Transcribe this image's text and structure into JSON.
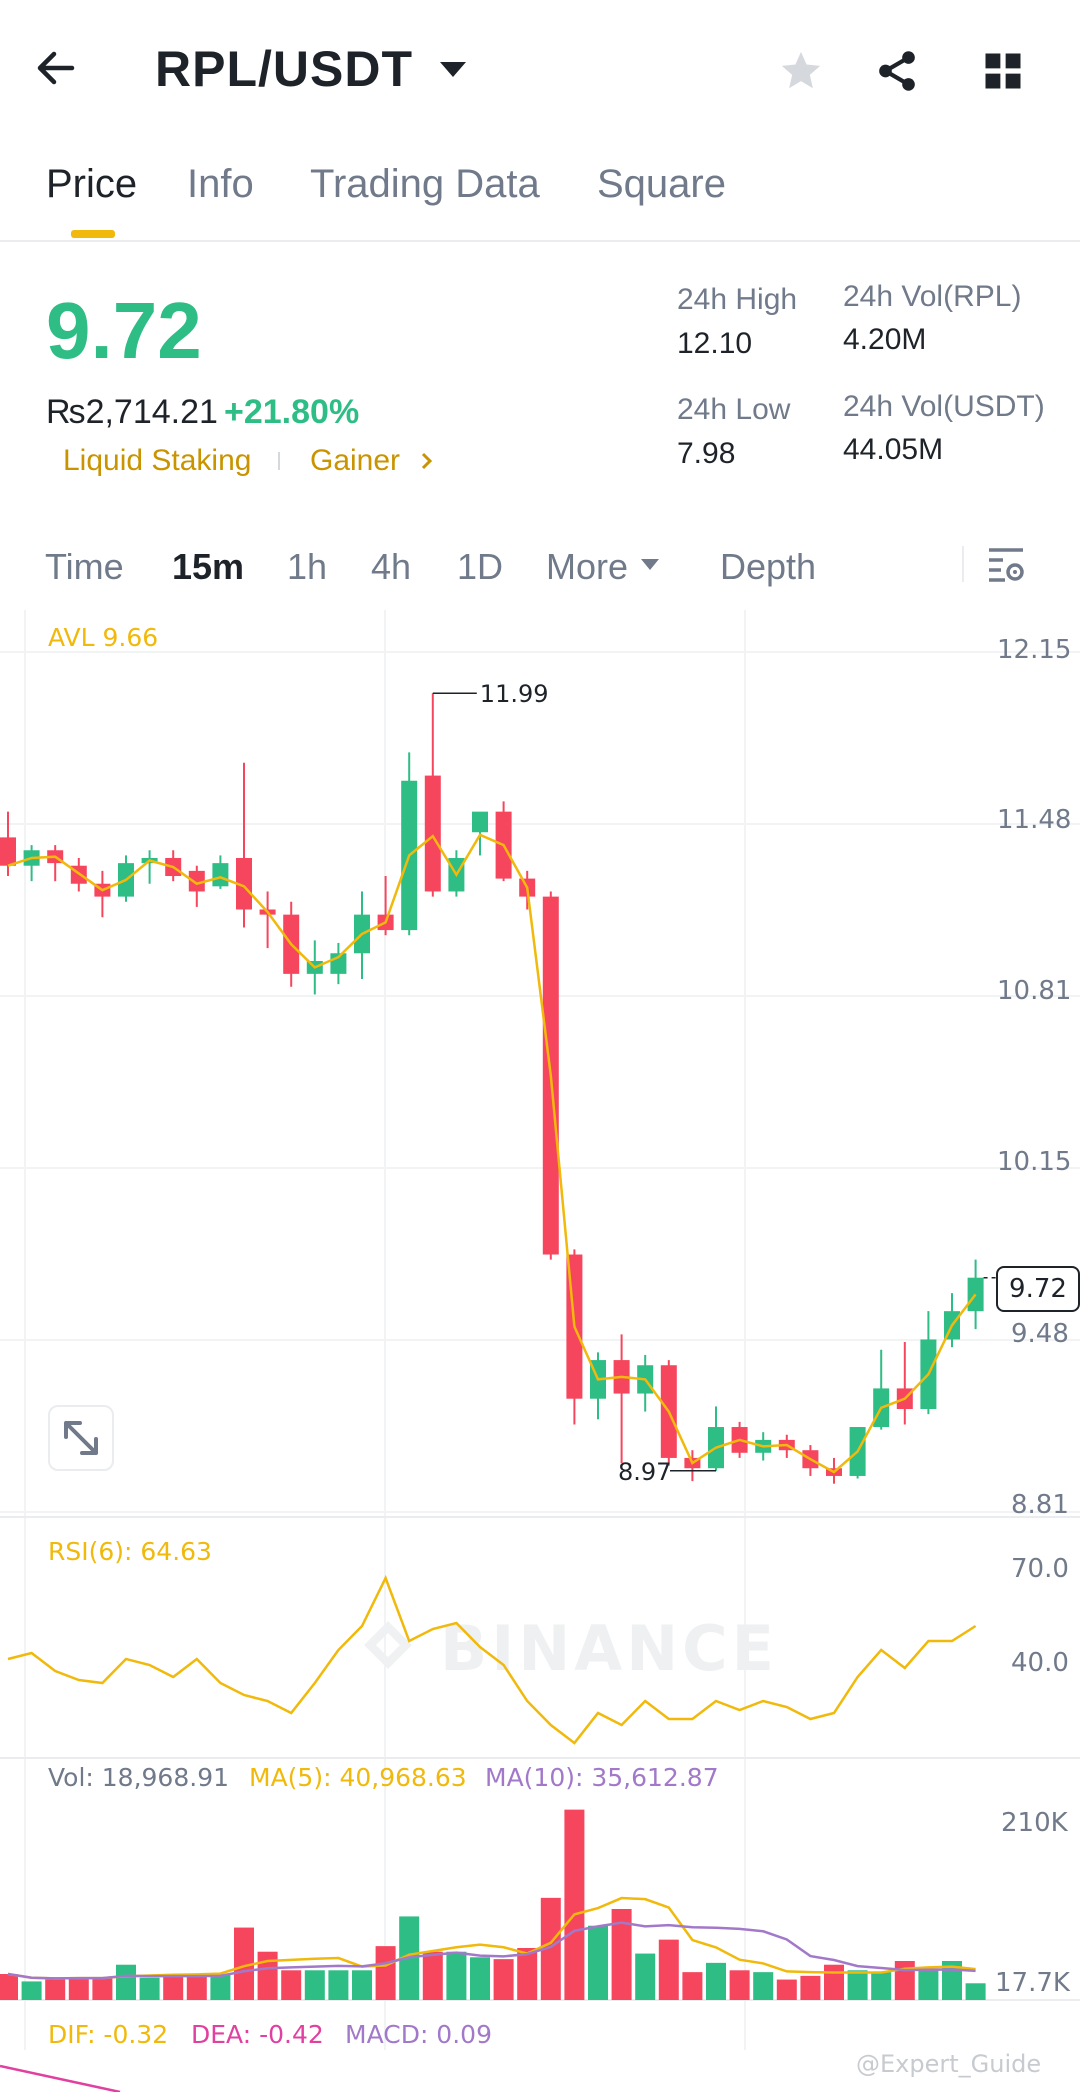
{
  "header": {
    "pair": "RPL/USDT"
  },
  "tabs": [
    {
      "label": "Price",
      "active": true
    },
    {
      "label": "Info"
    },
    {
      "label": "Trading Data"
    },
    {
      "label": "Square"
    }
  ],
  "price": {
    "last": "9.72",
    "fiat": "₨2,714.21",
    "change": "+21.80%",
    "tag1": "Liquid Staking",
    "tag2": "Gainer",
    "high_label": "24h High",
    "high": "12.10",
    "low_label": "24h Low",
    "low": "7.98",
    "vol_base_label": "24h Vol(RPL)",
    "vol_base": "4.20M",
    "vol_quote_label": "24h Vol(USDT)",
    "vol_quote": "44.05M"
  },
  "intervals": {
    "items": [
      "Time",
      "15m",
      "1h",
      "4h",
      "1D"
    ],
    "active": "15m",
    "more": "More",
    "depth": "Depth"
  },
  "colors": {
    "up": "#2ebd85",
    "down": "#f6465d",
    "avl": "#f0b90b",
    "ma10": "#a279c9",
    "dea": "#e040a0"
  },
  "chart_data": {
    "type": "candlestick",
    "price_axis_ticks": [
      "12.15",
      "11.48",
      "10.81",
      "10.15",
      "9.48",
      "8.81"
    ],
    "price_range": [
      8.81,
      12.15
    ],
    "avl_label": "AVL 9.66",
    "high_marker": "11.99",
    "low_marker": "8.97",
    "last_price_label": "9.72",
    "watermark": "BINANCE",
    "candles": [
      {
        "o": 11.43,
        "h": 11.53,
        "l": 11.28,
        "c": 11.32
      },
      {
        "o": 11.32,
        "h": 11.4,
        "l": 11.26,
        "c": 11.38
      },
      {
        "o": 11.38,
        "h": 11.4,
        "l": 11.26,
        "c": 11.33
      },
      {
        "o": 11.32,
        "h": 11.35,
        "l": 11.22,
        "c": 11.25
      },
      {
        "o": 11.25,
        "h": 11.3,
        "l": 11.12,
        "c": 11.2
      },
      {
        "o": 11.2,
        "h": 11.36,
        "l": 11.18,
        "c": 11.33
      },
      {
        "o": 11.33,
        "h": 11.38,
        "l": 11.25,
        "c": 11.35
      },
      {
        "o": 11.35,
        "h": 11.38,
        "l": 11.26,
        "c": 11.28
      },
      {
        "o": 11.3,
        "h": 11.32,
        "l": 11.16,
        "c": 11.22
      },
      {
        "o": 11.24,
        "h": 11.36,
        "l": 11.23,
        "c": 11.33
      },
      {
        "o": 11.35,
        "h": 11.72,
        "l": 11.08,
        "c": 11.15
      },
      {
        "o": 11.15,
        "h": 11.22,
        "l": 11.0,
        "c": 11.13
      },
      {
        "o": 11.13,
        "h": 11.18,
        "l": 10.85,
        "c": 10.9
      },
      {
        "o": 10.9,
        "h": 11.03,
        "l": 10.82,
        "c": 10.95
      },
      {
        "o": 10.9,
        "h": 11.02,
        "l": 10.86,
        "c": 10.98
      },
      {
        "o": 10.98,
        "h": 11.22,
        "l": 10.88,
        "c": 11.13
      },
      {
        "o": 11.13,
        "h": 11.28,
        "l": 11.05,
        "c": 11.07
      },
      {
        "o": 11.07,
        "h": 11.76,
        "l": 11.05,
        "c": 11.65
      },
      {
        "o": 11.67,
        "h": 11.99,
        "l": 11.2,
        "c": 11.22
      },
      {
        "o": 11.22,
        "h": 11.38,
        "l": 11.2,
        "c": 11.35
      },
      {
        "o": 11.45,
        "h": 11.5,
        "l": 11.36,
        "c": 11.53
      },
      {
        "o": 11.53,
        "h": 11.57,
        "l": 11.26,
        "c": 11.27
      },
      {
        "o": 11.27,
        "h": 11.3,
        "l": 11.15,
        "c": 11.2
      },
      {
        "o": 11.2,
        "h": 11.22,
        "l": 9.79,
        "c": 9.81
      },
      {
        "o": 9.81,
        "h": 9.83,
        "l": 9.15,
        "c": 9.25
      },
      {
        "o": 9.25,
        "h": 9.43,
        "l": 9.17,
        "c": 9.4
      },
      {
        "o": 9.4,
        "h": 9.5,
        "l": 9.0,
        "c": 9.27
      },
      {
        "o": 9.27,
        "h": 9.42,
        "l": 9.2,
        "c": 9.38
      },
      {
        "o": 9.38,
        "h": 9.4,
        "l": 8.99,
        "c": 9.02
      },
      {
        "o": 9.02,
        "h": 9.05,
        "l": 8.93,
        "c": 8.98
      },
      {
        "o": 8.98,
        "h": 9.22,
        "l": 8.97,
        "c": 9.14
      },
      {
        "o": 9.14,
        "h": 9.16,
        "l": 9.02,
        "c": 9.04
      },
      {
        "o": 9.04,
        "h": 9.12,
        "l": 9.01,
        "c": 9.09
      },
      {
        "o": 9.09,
        "h": 9.11,
        "l": 9.02,
        "c": 9.05
      },
      {
        "o": 9.05,
        "h": 9.07,
        "l": 8.95,
        "c": 8.98
      },
      {
        "o": 8.98,
        "h": 9.02,
        "l": 8.92,
        "c": 8.95
      },
      {
        "o": 8.95,
        "h": 9.14,
        "l": 8.94,
        "c": 9.14
      },
      {
        "o": 9.14,
        "h": 9.44,
        "l": 9.13,
        "c": 9.29
      },
      {
        "o": 9.29,
        "h": 9.47,
        "l": 9.15,
        "c": 9.21
      },
      {
        "o": 9.21,
        "h": 9.59,
        "l": 9.19,
        "c": 9.48
      },
      {
        "o": 9.48,
        "h": 9.66,
        "l": 9.45,
        "c": 9.59
      },
      {
        "o": 9.59,
        "h": 9.79,
        "l": 9.52,
        "c": 9.72
      }
    ],
    "rsi_label": "RSI(6): 64.63",
    "rsi_ticks": [
      "70.0",
      "40.0"
    ],
    "rsi": [
      52,
      54,
      48,
      45,
      44,
      52,
      50,
      46,
      52,
      44,
      40,
      38,
      34,
      44,
      55,
      63,
      79,
      58,
      62,
      64,
      56,
      50,
      38,
      30,
      24,
      34,
      30,
      38,
      32,
      32,
      38,
      35,
      38,
      36,
      32,
      34,
      46,
      55,
      49,
      58,
      58,
      63
    ],
    "volume_label": "Vol: 18,968.91",
    "ma5_label": "MA(5): 40,968.63",
    "ma10_label": "MA(10): 35,612.87",
    "volume_ticks": [
      "210K",
      "17.7K"
    ],
    "volume": [
      28,
      20,
      22,
      24,
      24,
      38,
      24,
      26,
      26,
      28,
      78,
      52,
      32,
      32,
      32,
      32,
      58,
      90,
      52,
      52,
      46,
      44,
      56,
      110,
      205,
      80,
      98,
      50,
      65,
      30,
      40,
      32,
      30,
      22,
      26,
      38,
      32,
      30,
      42,
      34,
      42,
      18
    ],
    "macd_label_dif": "DIF: -0.32",
    "macd_label_dea": "DEA: -0.42",
    "macd_label_macd": "MACD: 0.09"
  },
  "watermark_user": "@Expert_Guide"
}
